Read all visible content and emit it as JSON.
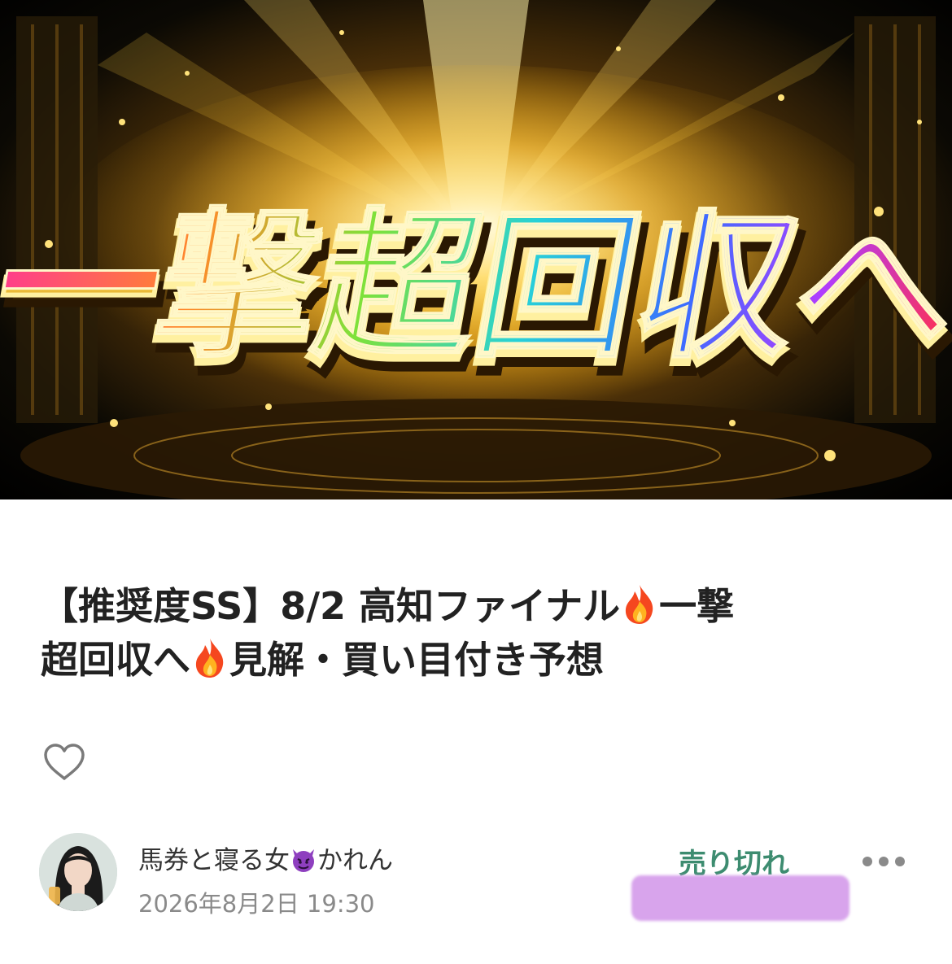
{
  "banner": {
    "headline": "一撃超回収へ"
  },
  "article": {
    "title_line1": "【推奨度SS】8/2 高知ファイナル",
    "title_line1b": "一撃",
    "title_line2a": "超回収へ",
    "title_line2b": "見解・買い目付き予想",
    "title_icon": "fire-emoji"
  },
  "actions": {
    "like_icon": "heart-outline-icon",
    "more_icon": "more-dots-icon"
  },
  "author": {
    "name": "馬券と寝る女",
    "name_suffix": "かれん",
    "name_icon": "devil-emoji",
    "published": "2026年8月2日 19:30"
  },
  "purchase": {
    "status": "売り切れ",
    "status_color": "#3d8c70"
  }
}
